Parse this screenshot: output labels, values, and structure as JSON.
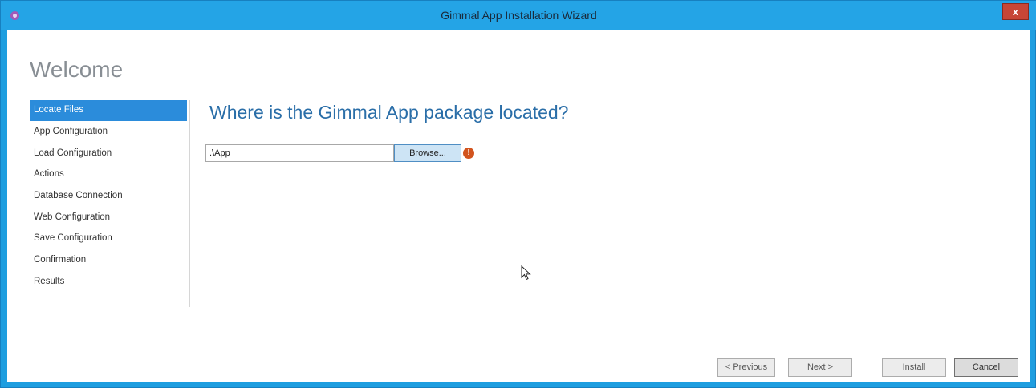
{
  "window": {
    "title": "Gimmal App Installation Wizard",
    "close_label": "x",
    "accent": "#1e9ee0"
  },
  "page": {
    "heading": "Welcome",
    "question": "Where is the Gimmal App package located?"
  },
  "nav": {
    "items": [
      {
        "label": "Locate Files",
        "active": true
      },
      {
        "label": "App Configuration"
      },
      {
        "label": "Load Configuration"
      },
      {
        "label": "Actions"
      },
      {
        "label": "Database Connection"
      },
      {
        "label": "Web Configuration"
      },
      {
        "label": "Save Configuration"
      },
      {
        "label": "Confirmation"
      },
      {
        "label": "Results"
      }
    ]
  },
  "form": {
    "path_value": ".\\App",
    "browse_label": "Browse...",
    "error_icon": "!"
  },
  "buttons": {
    "previous": "< Previous",
    "next": "Next >",
    "install": "Install",
    "cancel": "Cancel"
  }
}
